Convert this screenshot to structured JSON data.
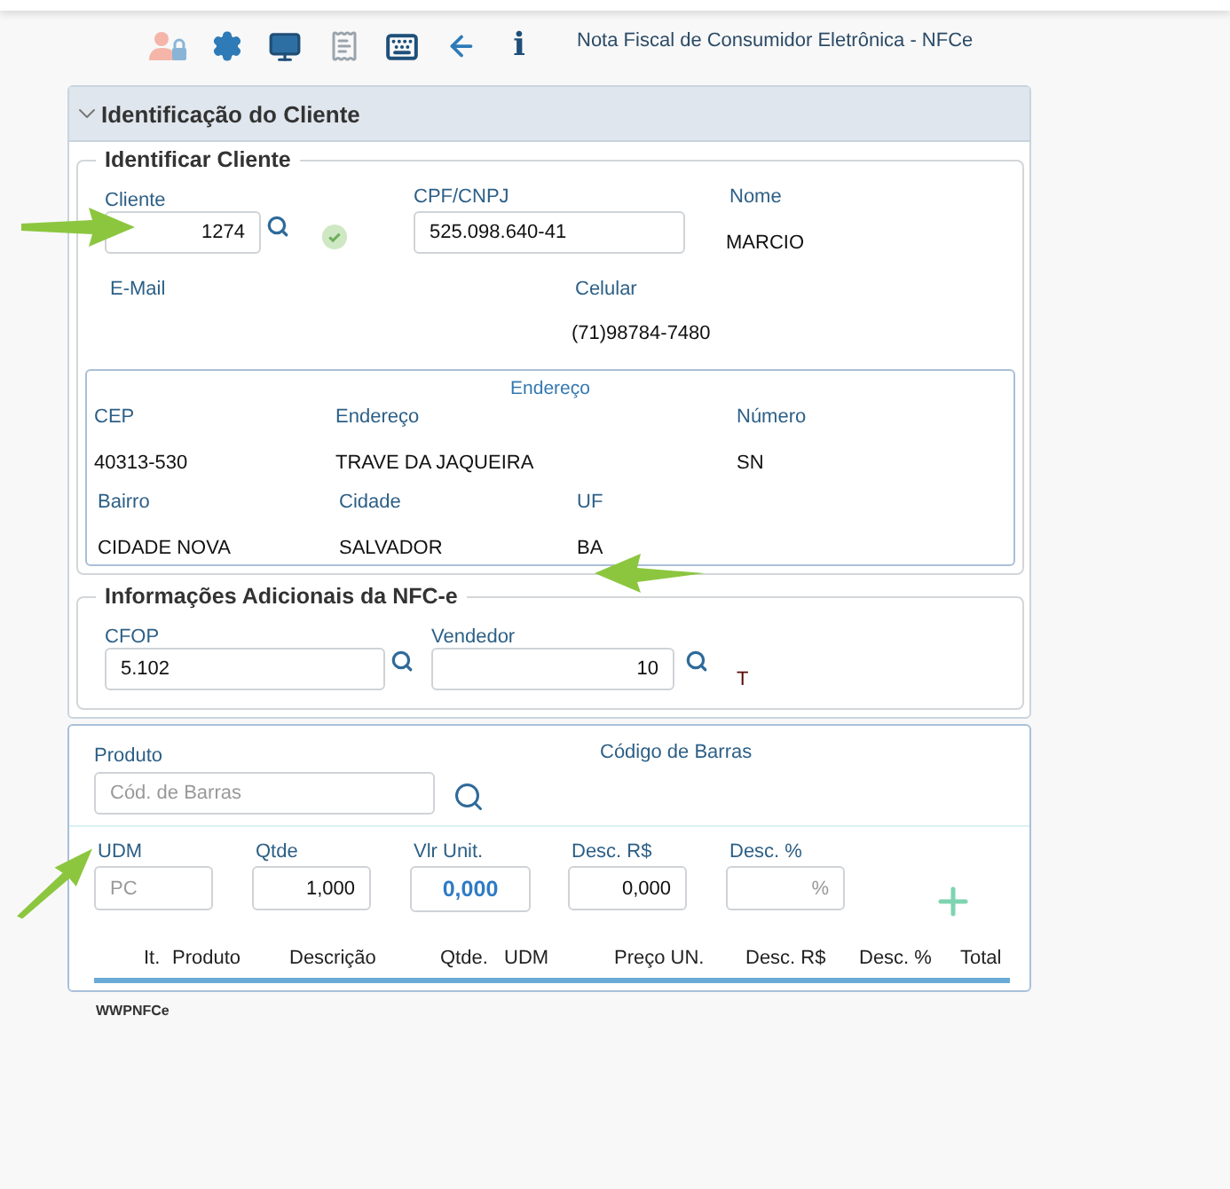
{
  "toolbar": {
    "info_glyph": "i",
    "title": "Nota Fiscal de Consumidor Eletrônica - NFCe"
  },
  "panel": {
    "title": "Identificação do Cliente",
    "expanded": true
  },
  "client": {
    "legend": "Identificar Cliente",
    "cliente": {
      "label": "Cliente",
      "value": "1274",
      "verified": true
    },
    "cpf": {
      "label": "CPF/CNPJ",
      "value": "525.098.640-41"
    },
    "nome": {
      "label": "Nome",
      "value": "MARCIO"
    },
    "email": {
      "label": "E-Mail"
    },
    "celular": {
      "label": "Celular",
      "value": "(71)98784-7480"
    },
    "address": {
      "title": "Endereço",
      "rows": [
        [
          {
            "label": "CEP",
            "value": "40313-530"
          },
          {
            "label": "Endereço",
            "value": "TRAVE DA JAQUEIRA"
          },
          {
            "label": "Número",
            "value": "SN"
          }
        ],
        [
          {
            "label": "Bairro",
            "value": "CIDADE NOVA"
          },
          {
            "label": "Cidade",
            "value": "SALVADOR"
          },
          {
            "label": "UF",
            "value": "BA"
          }
        ]
      ]
    }
  },
  "additional": {
    "legend": "Informações Adicionais da NFC-e",
    "cfop": {
      "label": "CFOP",
      "value": "5.102"
    },
    "vendedor": {
      "label": "Vendedor",
      "value": "10"
    },
    "note": "T"
  },
  "product": {
    "label": "Produto",
    "placeholder": "Cód. de Barras",
    "barcode_label": "Código de Barras",
    "fields": [
      {
        "label": "UDM",
        "placeholder": "PC"
      },
      {
        "label": "Qtde",
        "value": "1,000"
      },
      {
        "label": "Vlr Unit.",
        "value": "0,000",
        "emphasis": true
      },
      {
        "label": "Desc. R$",
        "value": "0,000"
      },
      {
        "label": "Desc. %",
        "placeholder": "%"
      }
    ],
    "columns": [
      "It.",
      "Produto",
      "Descrição",
      "Qtde.",
      "UDM",
      "Preço UN.",
      "Desc. R$",
      "Desc. %",
      "Total"
    ]
  },
  "footer": "WWPNFCe"
}
